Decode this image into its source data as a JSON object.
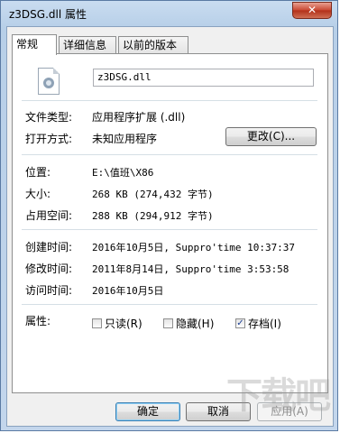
{
  "window": {
    "title": "z3DSG.dll 属性",
    "close_glyph": "✕"
  },
  "tabs": [
    "常规",
    "详细信息",
    "以前的版本"
  ],
  "file": {
    "name": "z3DSG.dll"
  },
  "rows": {
    "type_label": "文件类型:",
    "type_value": "应用程序扩展 (.dll)",
    "opens_label": "打开方式:",
    "opens_value": "未知应用程序",
    "change_button": "更改(C)...",
    "location_label": "位置:",
    "location_value": "E:\\值班\\X86",
    "size_label": "大小:",
    "size_value": "268 KB (274,432 字节)",
    "disk_label": "占用空间:",
    "disk_value": "288 KB (294,912 字节)",
    "created_label": "创建时间:",
    "created_value": "2016年10月5日, Suppro'time 10:37:37",
    "modified_label": "修改时间:",
    "modified_value": "2011年8月14日, Suppro'time 3:53:58",
    "accessed_label": "访问时间:",
    "accessed_value": "2016年10月5日"
  },
  "attributes": {
    "label": "属性:",
    "readonly": {
      "label": "只读(R)",
      "checked": false
    },
    "hidden": {
      "label": "隐藏(H)",
      "checked": false
    },
    "archive": {
      "label": "存档(I)",
      "checked": true
    }
  },
  "buttons": {
    "ok": "确定",
    "cancel": "取消",
    "apply": "应用(A)"
  },
  "watermark": "下载吧",
  "check_glyph": "✓",
  "icons": [
    "close-icon",
    "dll-file-icon",
    "checkbox-checked-icon"
  ]
}
